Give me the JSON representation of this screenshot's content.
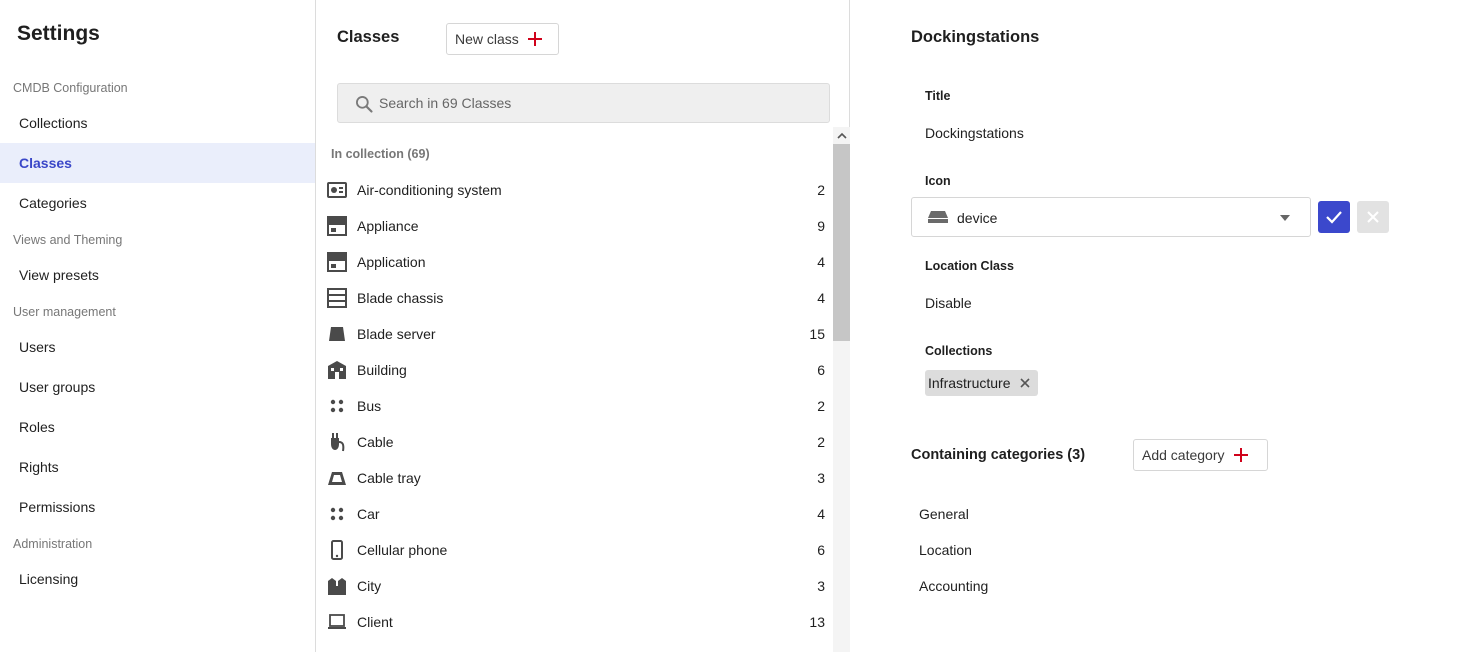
{
  "sidebar": {
    "title": "Settings",
    "sections": [
      {
        "label": "CMDB Configuration",
        "items": [
          "Collections",
          "Classes",
          "Categories"
        ]
      },
      {
        "label": "Views and Theming",
        "items": [
          "View presets"
        ]
      },
      {
        "label": "User management",
        "items": [
          "Users",
          "User groups",
          "Roles",
          "Rights",
          "Permissions"
        ]
      },
      {
        "label": "Administration",
        "items": [
          "Licensing"
        ]
      }
    ],
    "active_item": "Classes"
  },
  "classes_panel": {
    "title": "Classes",
    "new_button_label": "New class",
    "search_placeholder": "Search in 69 Classes",
    "collection_label": "In collection (69)",
    "items": [
      {
        "name": "Air-conditioning system",
        "count": "2",
        "icon": "air-conditioner-icon"
      },
      {
        "name": "Appliance",
        "count": "9",
        "icon": "appliance-icon"
      },
      {
        "name": "Application",
        "count": "4",
        "icon": "application-icon"
      },
      {
        "name": "Blade chassis",
        "count": "4",
        "icon": "blade-chassis-icon"
      },
      {
        "name": "Blade server",
        "count": "15",
        "icon": "blade-server-icon"
      },
      {
        "name": "Building",
        "count": "6",
        "icon": "building-icon"
      },
      {
        "name": "Bus",
        "count": "2",
        "icon": "bus-icon"
      },
      {
        "name": "Cable",
        "count": "2",
        "icon": "cable-icon"
      },
      {
        "name": "Cable tray",
        "count": "3",
        "icon": "cable-tray-icon"
      },
      {
        "name": "Car",
        "count": "4",
        "icon": "car-icon"
      },
      {
        "name": "Cellular phone",
        "count": "6",
        "icon": "cellular-phone-icon"
      },
      {
        "name": "City",
        "count": "3",
        "icon": "city-icon"
      },
      {
        "name": "Client",
        "count": "13",
        "icon": "client-icon"
      }
    ]
  },
  "detail": {
    "title": "Dockingstations",
    "title_label": "Title",
    "title_value": "Dockingstations",
    "icon_label": "Icon",
    "icon_value": "device",
    "location_label": "Location Class",
    "location_value": "Disable",
    "collections_label": "Collections",
    "collections": [
      "Infrastructure"
    ],
    "categories_title": "Containing categories (3)",
    "add_category_label": "Add category",
    "categories": [
      "General",
      "Location",
      "Accounting"
    ]
  },
  "colors": {
    "accent": "#3b48cc",
    "active_bg": "#eaeefb",
    "plus_red": "#d0021b"
  }
}
